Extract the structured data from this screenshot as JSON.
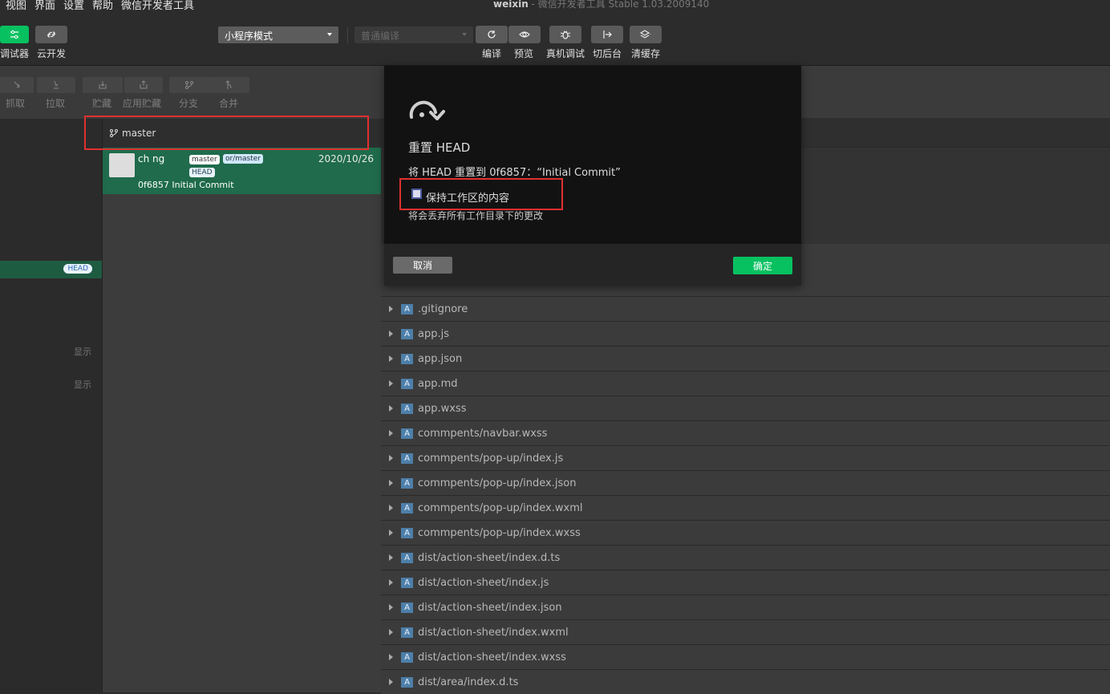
{
  "menu": {
    "items": [
      "视图",
      "界面",
      "设置",
      "帮助",
      "微信开发者工具"
    ]
  },
  "window": {
    "app": "weixin",
    "subtitle": " - 微信开发者工具 Stable 1.03.2009140"
  },
  "toolbar": {
    "debugger_label": "调试器",
    "cloud_label": "云开发",
    "mode_select": "小程序模式",
    "compile_select": "普通编译",
    "compile_label": "编译",
    "preview_label": "预览",
    "realdevice_label": "真机调试",
    "background_label": "切后台",
    "clearcache_label": "清缓存"
  },
  "git_toolbar": {
    "fetch": "抓取",
    "pull": "拉取",
    "stash": "贮藏",
    "apply_stash": "应用贮藏",
    "branch": "分支",
    "merge": "合并"
  },
  "sidebar": {
    "head_badge": "HEAD",
    "show1": "显示",
    "show2": "显示"
  },
  "commits": {
    "branch": "master",
    "author": "ch      ng",
    "tag_master": "master",
    "tag_remote": "or/master",
    "tag_head": "HEAD",
    "date": "2020/10/26",
    "message": "0f6857  Initial Commit"
  },
  "files": [
    ".gitignore",
    "app.js",
    "app.json",
    "app.md",
    "app.wxss",
    "commpents/navbar.wxss",
    "commpents/pop-up/index.js",
    "commpents/pop-up/index.json",
    "commpents/pop-up/index.wxml",
    "commpents/pop-up/index.wxss",
    "dist/action-sheet/index.d.ts",
    "dist/action-sheet/index.js",
    "dist/action-sheet/index.json",
    "dist/action-sheet/index.wxml",
    "dist/action-sheet/index.wxss",
    "dist/area/index.d.ts"
  ],
  "file_status": "A",
  "modal": {
    "title": "重置 HEAD",
    "desc": "将 HEAD 重置到 0f6857：“Initial Commit”",
    "checkbox_label": "保持工作区的内容",
    "warning": "将会丢弃所有工作目录下的更改",
    "cancel": "取消",
    "ok": "确定"
  },
  "colors": {
    "accent": "#07c160",
    "highlight_box": "#e03030"
  }
}
